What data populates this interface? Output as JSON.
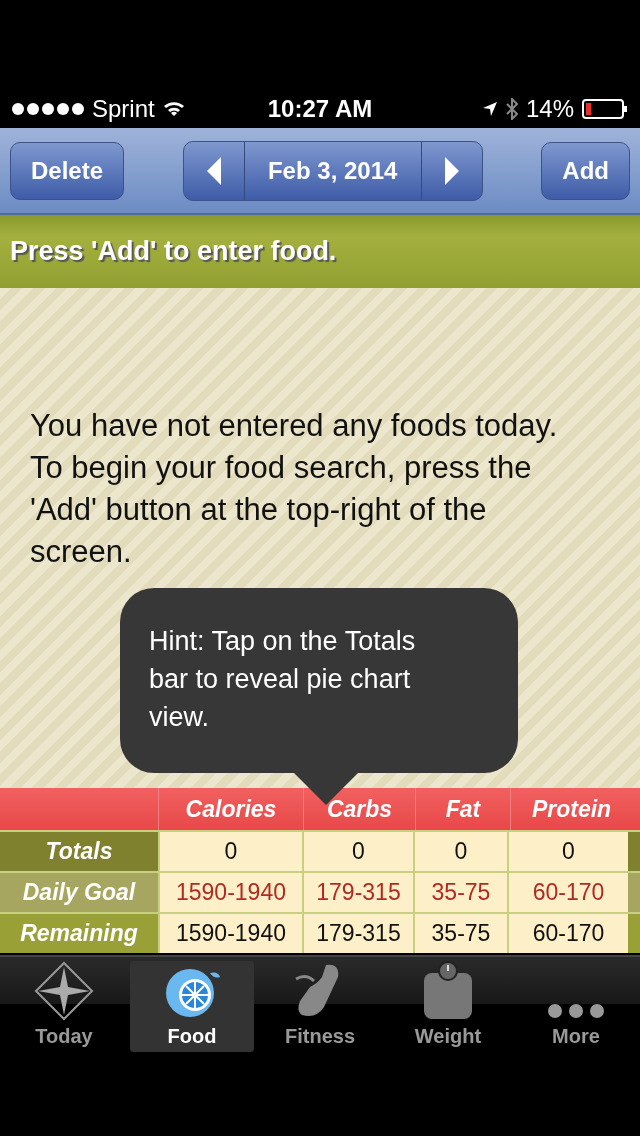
{
  "status_bar": {
    "carrier": "Sprint",
    "time": "10:27 AM",
    "battery": "14%"
  },
  "nav": {
    "left_button": "Delete",
    "date": "Feb 3, 2014",
    "right_button": "Add"
  },
  "banner": "Press 'Add' to enter food.",
  "message": "You have not entered any foods today. To begin your food search, press the 'Add' button at the top-right of the screen.",
  "hint": "Hint: Tap on the Totals bar to reveal pie chart view.",
  "table": {
    "columns": [
      "Calories",
      "Carbs",
      "Fat",
      "Protein"
    ],
    "rows": [
      {
        "label": "Totals",
        "kind": "totals",
        "cells": [
          "0",
          "0",
          "0",
          "0"
        ]
      },
      {
        "label": "Daily Goal",
        "kind": "goal",
        "cells": [
          "1590-1940",
          "179-315",
          "35-75",
          "60-170"
        ]
      },
      {
        "label": "Remaining",
        "kind": "remaining",
        "cells": [
          "1590-1940",
          "179-315",
          "35-75",
          "60-170"
        ]
      }
    ]
  },
  "tabs": [
    {
      "label": "Today",
      "selected": false
    },
    {
      "label": "Food",
      "selected": true
    },
    {
      "label": "Fitness",
      "selected": false
    },
    {
      "label": "Weight",
      "selected": false
    },
    {
      "label": "More",
      "selected": false
    }
  ]
}
